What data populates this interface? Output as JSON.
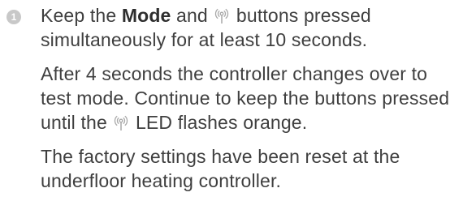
{
  "step": {
    "number": "1"
  },
  "instruction": {
    "line1_start": "Keep the ",
    "mode_label": "Mode",
    "line1_mid": " and ",
    "line1_end": " buttons pressed",
    "line2": "simultaneously for at least 10 seconds."
  },
  "note": {
    "part1": "After 4 seconds the controller changes over to test mode. Continue to keep the buttons pressed until the ",
    "part2": " LED flashes orange."
  },
  "result": {
    "text": "The factory settings have been reset at the underfloor heating controller."
  },
  "icons": {
    "radio": "radio-antenna-icon"
  },
  "colors": {
    "text": "#3f3f3f",
    "marker": "#c8c8c8"
  }
}
